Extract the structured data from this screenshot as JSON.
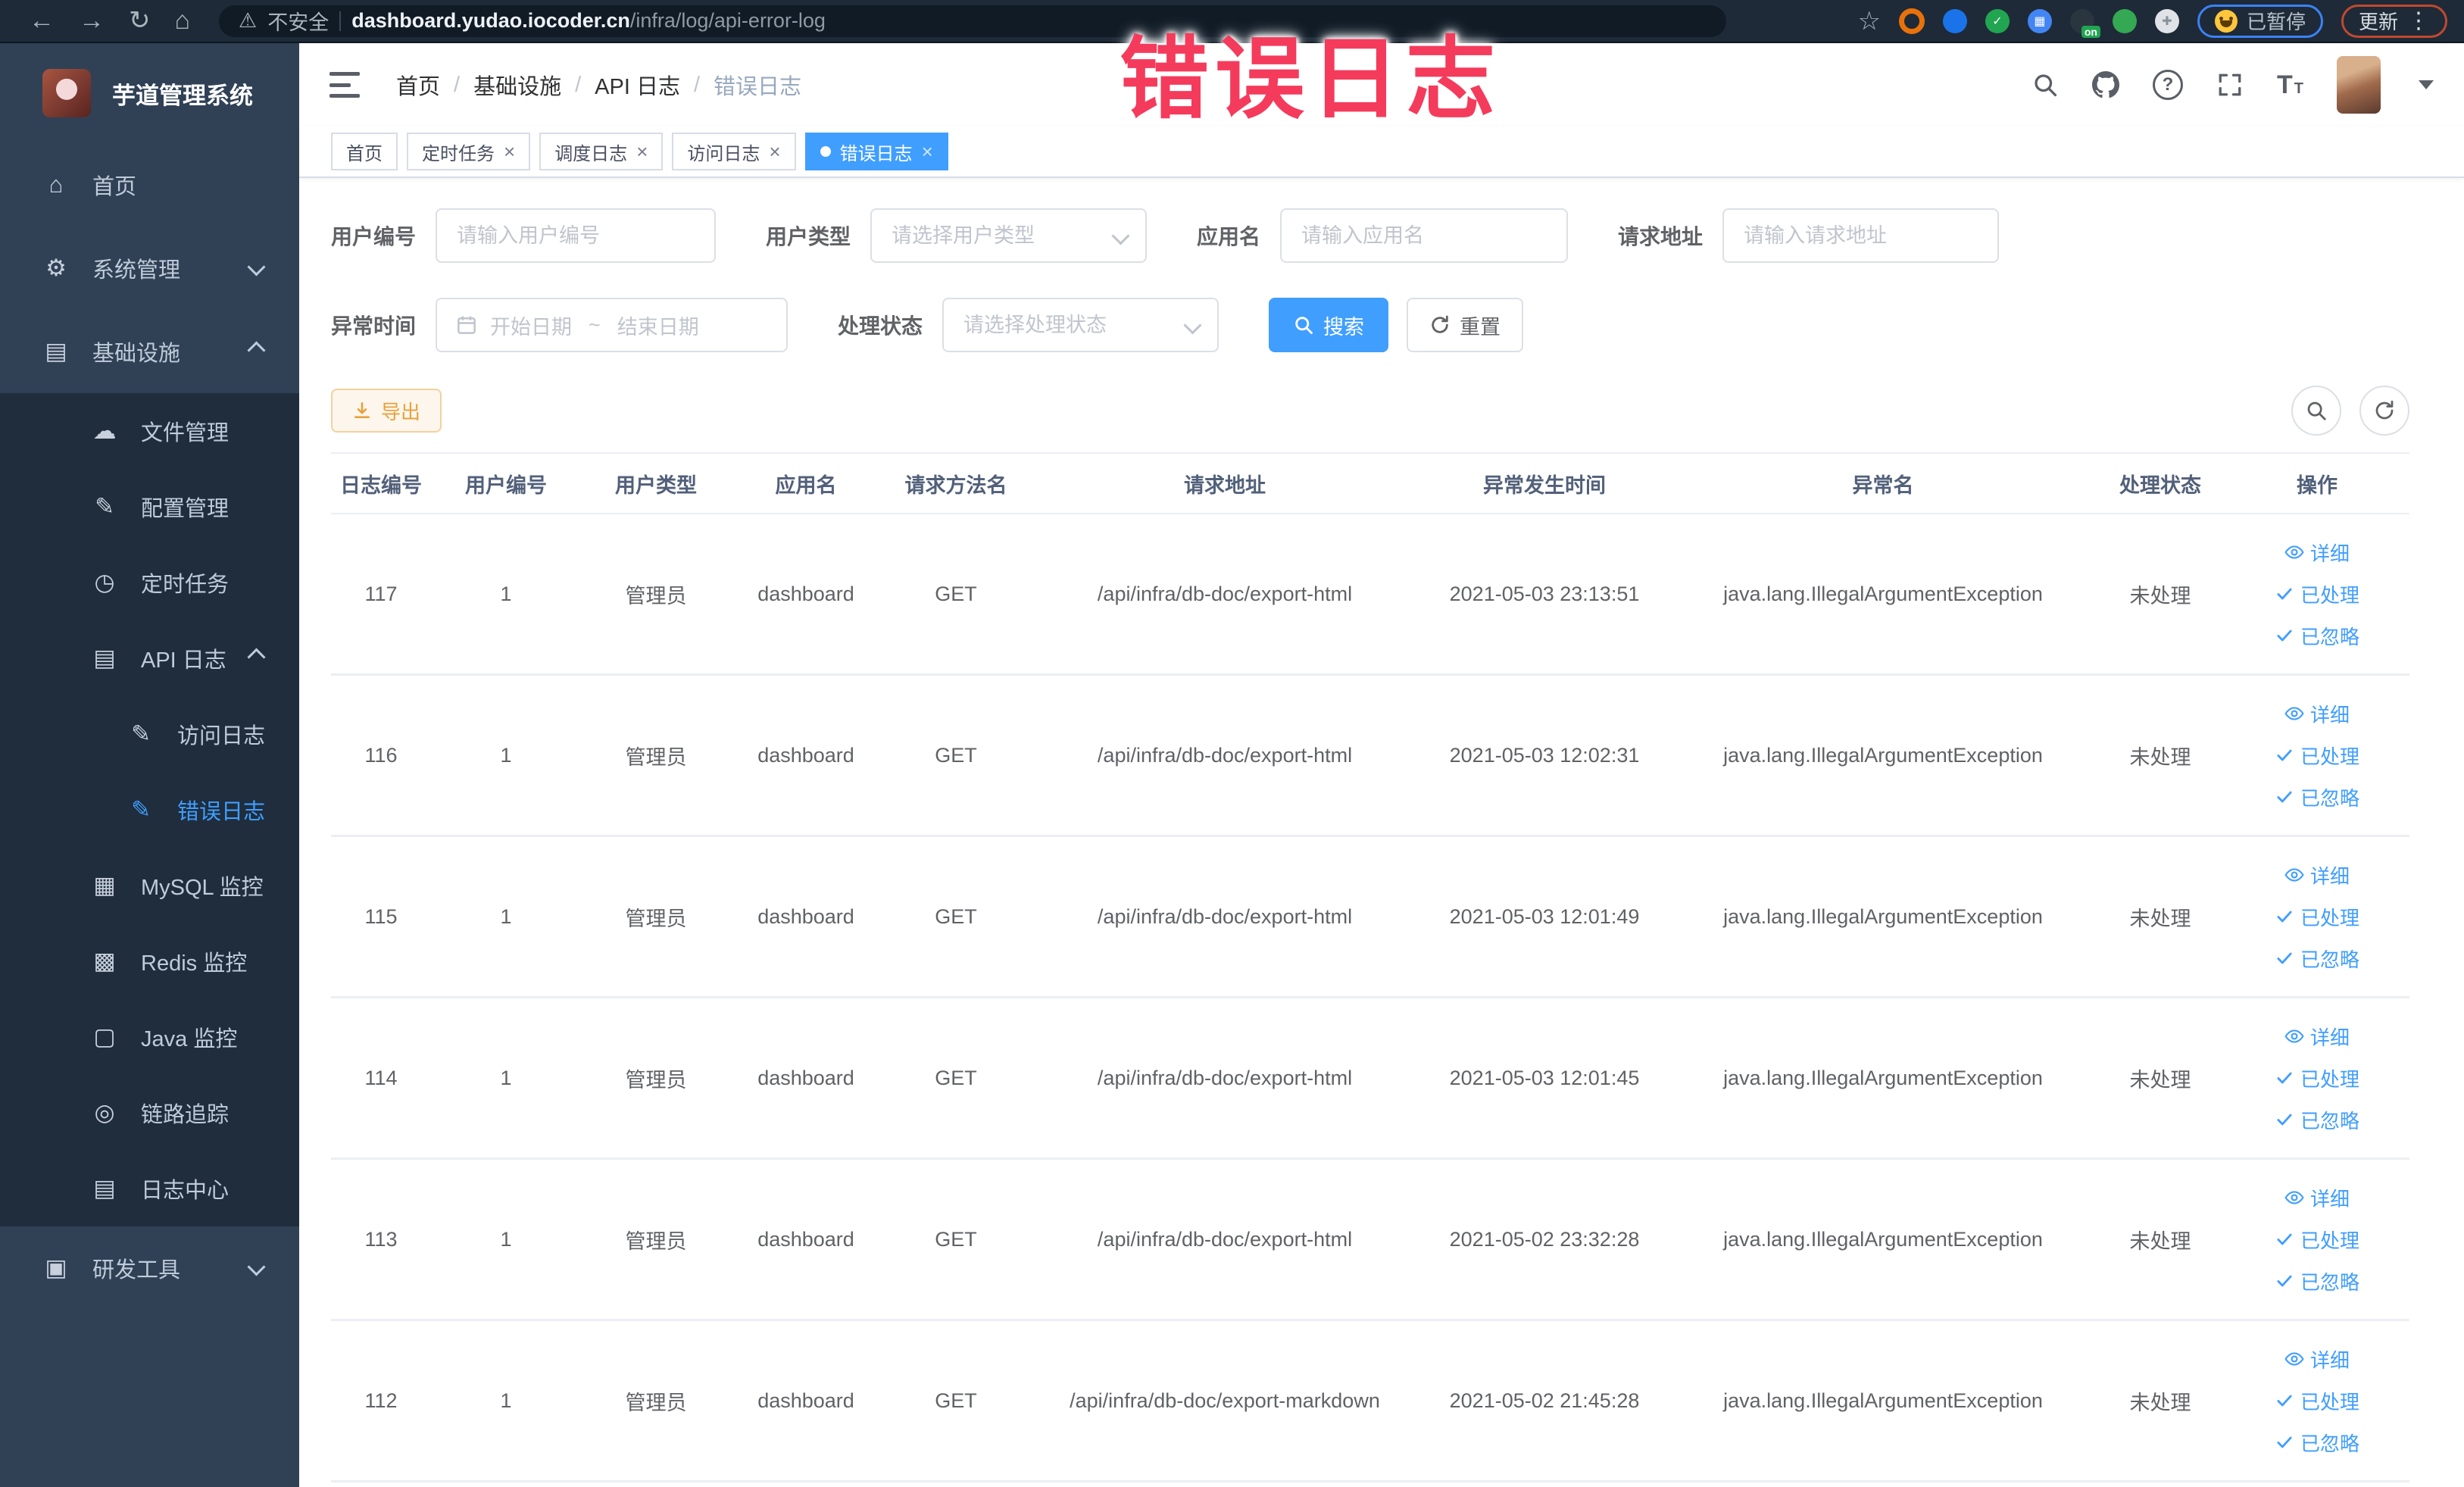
{
  "colors": {
    "primary": "#409eff",
    "sidebar_bg": "#304156",
    "submenu_bg": "#1f2d3d",
    "annotation": "#f43b5c",
    "export_text": "#e6a23c",
    "tab_active_bg": "#409eff"
  },
  "annotation": {
    "text": "错误日志"
  },
  "browser": {
    "security_label": "不安全",
    "url_host": "dashboard.yudao.iocoder.cn",
    "url_path": "/infra/log/api-error-log",
    "paused_label": "已暂停",
    "update_label": "更新",
    "extensions": [
      {
        "name": "extension-orange-ring-icon",
        "style": "ring",
        "color": "#e8710a"
      },
      {
        "name": "extension-blue-gem-icon",
        "style": "fill",
        "color": "#1a73e8"
      },
      {
        "name": "extension-green-check-icon",
        "style": "fill",
        "color": "#21a551",
        "glyph": "✓"
      },
      {
        "name": "extension-grid-icon",
        "style": "fill",
        "color": "#4285f4",
        "glyph": "▦"
      },
      {
        "name": "extension-switch-icon",
        "style": "fill",
        "color": "#2b3540",
        "badge": "on"
      },
      {
        "name": "extension-leaf-icon",
        "style": "fill",
        "color": "#34a853"
      },
      {
        "name": "extensions-puzzle-icon",
        "style": "fill",
        "color": "#dfe3e8",
        "glyph": "✚"
      }
    ]
  },
  "sidebar": {
    "title": "芋道管理系统",
    "menu": [
      {
        "key": "home",
        "label": "首页",
        "icon": "home-icon",
        "level": 0
      },
      {
        "key": "system-manage",
        "label": "系统管理",
        "icon": "gear-icon",
        "level": 0,
        "chevron": "down"
      },
      {
        "key": "infra",
        "label": "基础设施",
        "icon": "infra-icon",
        "level": 0,
        "chevron": "up"
      },
      {
        "key": "file-manage",
        "label": "文件管理",
        "icon": "cloud-upload-icon",
        "level": 1,
        "group": "infra"
      },
      {
        "key": "config-manage",
        "label": "配置管理",
        "icon": "edit-doc-icon",
        "level": 1,
        "group": "infra"
      },
      {
        "key": "scheduled-job",
        "label": "定时任务",
        "icon": "clock-icon",
        "level": 1,
        "group": "infra"
      },
      {
        "key": "api-log",
        "label": "API 日志",
        "icon": "api-log-icon",
        "level": 1,
        "group": "infra",
        "chevron": "up"
      },
      {
        "key": "access-log",
        "label": "访问日志",
        "icon": "doc-edit-icon",
        "level": 2,
        "group": "infra"
      },
      {
        "key": "error-log",
        "label": "错误日志",
        "icon": "doc-edit-icon",
        "level": 2,
        "group": "infra",
        "active": true
      },
      {
        "key": "mysql-monitor",
        "label": "MySQL 监控",
        "icon": "database-icon",
        "level": 1,
        "group": "infra"
      },
      {
        "key": "redis-monitor",
        "label": "Redis 监控",
        "icon": "stack-icon",
        "level": 1,
        "group": "infra"
      },
      {
        "key": "java-monitor",
        "label": "Java 监控",
        "icon": "monitor-icon",
        "level": 1,
        "group": "infra"
      },
      {
        "key": "trace",
        "label": "链路追踪",
        "icon": "eye-icon",
        "level": 1,
        "group": "infra"
      },
      {
        "key": "log-center",
        "label": "日志中心",
        "icon": "log-doc-icon",
        "level": 1,
        "group": "infra"
      },
      {
        "key": "dev-tools",
        "label": "研发工具",
        "icon": "toolbox-icon",
        "level": 0,
        "chevron": "down"
      }
    ]
  },
  "header": {
    "breadcrumb": [
      "首页",
      "基础设施",
      "API 日志",
      "错误日志"
    ]
  },
  "tabs": [
    {
      "label": "首页",
      "closable": false,
      "active": false
    },
    {
      "label": "定时任务",
      "closable": true,
      "active": false
    },
    {
      "label": "调度日志",
      "closable": true,
      "active": false
    },
    {
      "label": "访问日志",
      "closable": true,
      "active": false
    },
    {
      "label": "错误日志",
      "closable": true,
      "active": true
    }
  ],
  "filters": {
    "user_id": {
      "label": "用户编号",
      "placeholder": "请输入用户编号"
    },
    "user_type": {
      "label": "用户类型",
      "placeholder": "请选择用户类型"
    },
    "app_name": {
      "label": "应用名",
      "placeholder": "请输入应用名"
    },
    "request_url": {
      "label": "请求地址",
      "placeholder": "请输入请求地址"
    },
    "exception_time": {
      "label": "异常时间",
      "start_placeholder": "开始日期",
      "separator": "~",
      "end_placeholder": "结束日期"
    },
    "process_status": {
      "label": "处理状态",
      "placeholder": "请选择处理状态"
    },
    "search_label": "搜索",
    "reset_label": "重置"
  },
  "toolbar": {
    "export_label": "导出"
  },
  "table": {
    "columns": [
      "日志编号",
      "用户编号",
      "用户类型",
      "应用名",
      "请求方法名",
      "请求地址",
      "异常发生时间",
      "异常名",
      "处理状态",
      "操作"
    ],
    "actions": [
      {
        "label": "详细",
        "icon": "view-eye-icon"
      },
      {
        "label": "已处理",
        "icon": "check-icon"
      },
      {
        "label": "已忽略",
        "icon": "check-icon"
      }
    ],
    "rows": [
      {
        "id": "117",
        "user_id": "1",
        "user_type": "管理员",
        "app": "dashboard",
        "method": "GET",
        "url": "/api/infra/db-doc/export-html",
        "time": "2021-05-03 23:13:51",
        "exception": "java.lang.IllegalArgumentException",
        "status": "未处理"
      },
      {
        "id": "116",
        "user_id": "1",
        "user_type": "管理员",
        "app": "dashboard",
        "method": "GET",
        "url": "/api/infra/db-doc/export-html",
        "time": "2021-05-03 12:02:31",
        "exception": "java.lang.IllegalArgumentException",
        "status": "未处理"
      },
      {
        "id": "115",
        "user_id": "1",
        "user_type": "管理员",
        "app": "dashboard",
        "method": "GET",
        "url": "/api/infra/db-doc/export-html",
        "time": "2021-05-03 12:01:49",
        "exception": "java.lang.IllegalArgumentException",
        "status": "未处理"
      },
      {
        "id": "114",
        "user_id": "1",
        "user_type": "管理员",
        "app": "dashboard",
        "method": "GET",
        "url": "/api/infra/db-doc/export-html",
        "time": "2021-05-03 12:01:45",
        "exception": "java.lang.IllegalArgumentException",
        "status": "未处理"
      },
      {
        "id": "113",
        "user_id": "1",
        "user_type": "管理员",
        "app": "dashboard",
        "method": "GET",
        "url": "/api/infra/db-doc/export-html",
        "time": "2021-05-02 23:32:28",
        "exception": "java.lang.IllegalArgumentException",
        "status": "未处理"
      },
      {
        "id": "112",
        "user_id": "1",
        "user_type": "管理员",
        "app": "dashboard",
        "method": "GET",
        "url": "/api/infra/db-doc/export-markdown",
        "time": "2021-05-02 21:45:28",
        "exception": "java.lang.IllegalArgumentException",
        "status": "未处理"
      }
    ]
  }
}
